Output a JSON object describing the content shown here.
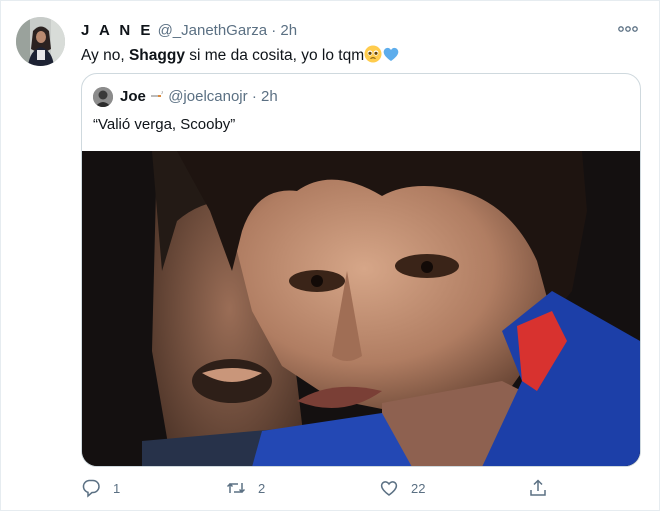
{
  "author": {
    "name": "J A N E",
    "handle": "@_JanethGarza",
    "separator": "·",
    "time": "2h"
  },
  "tweet": {
    "text_before": "Ay no, ",
    "text_bold": "Shaggy",
    "text_after": " si me da cosita, yo lo tqm",
    "emojis": [
      "pleading-face-emoji",
      "blue-heart-emoji"
    ]
  },
  "quote": {
    "name": "Joe",
    "handle": "@joelcanojr",
    "separator": "·",
    "time": "2h",
    "text": "“Valió verga, Scooby”"
  },
  "actions": {
    "reply_count": "1",
    "retweet_count": "2",
    "like_count": "22",
    "share_count": ""
  },
  "colors": {
    "text_primary": "#0f1419",
    "text_secondary": "#5b7083",
    "border": "#cfd9de",
    "accent_blue": "#1da1f2"
  }
}
